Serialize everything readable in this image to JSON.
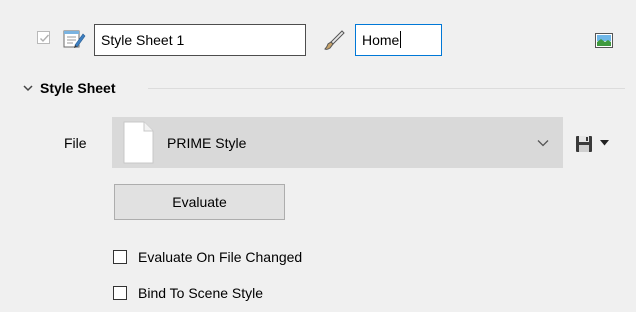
{
  "header": {
    "enabled_checked": true,
    "sheet_icon": "style-sheet-icon",
    "name_value": "Style Sheet 1",
    "brush_icon": "brush-icon",
    "tag_value": "Home",
    "image_icon": "image-icon"
  },
  "section": {
    "title": "Style Sheet",
    "expanded": true
  },
  "file": {
    "label": "File",
    "value": "PRIME Style",
    "doc_icon": "document-icon",
    "dropdown_icon": "chevron-down-icon",
    "save_icon": "save-icon",
    "save_menu_icon": "dropdown-arrow-icon"
  },
  "evaluate_button": "Evaluate",
  "options": [
    {
      "label": "Evaluate On File Changed",
      "checked": false
    },
    {
      "label": "Bind To Scene Style",
      "checked": false
    }
  ],
  "colors": {
    "panel_background": "#f0f0f0",
    "focus_border": "#0078d7",
    "combo_background": "#d9d9d9"
  }
}
